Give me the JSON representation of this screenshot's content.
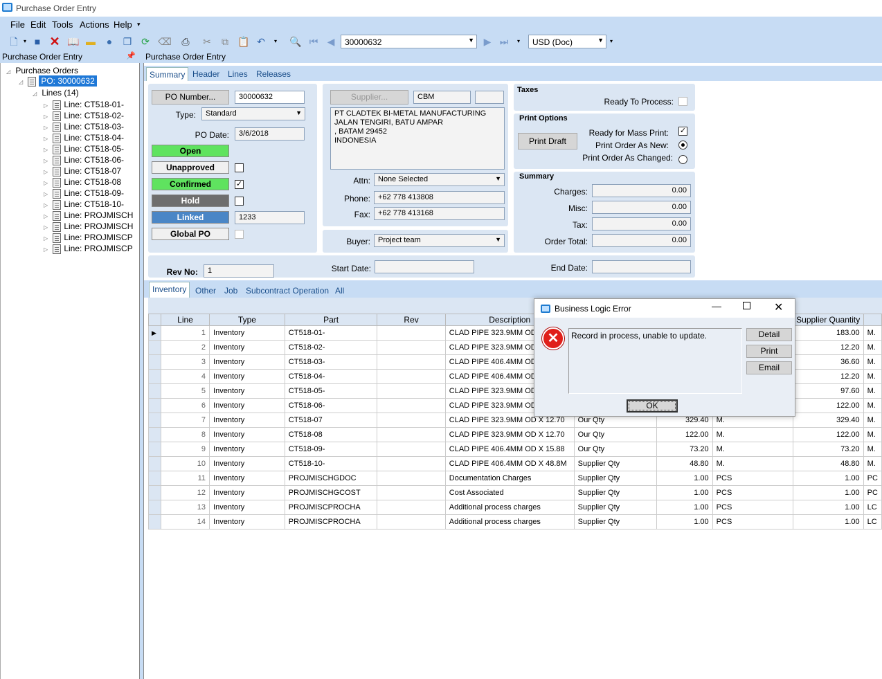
{
  "window": {
    "title": "Purchase Order Entry"
  },
  "menu": [
    "File",
    "Edit",
    "Tools",
    "Actions",
    "Help"
  ],
  "toolbar": {
    "po_number": "30000632",
    "currency": "USD (Doc)"
  },
  "left_panel": {
    "title": "Purchase Order Entry"
  },
  "right_panel": {
    "title": "Purchase Order Entry"
  },
  "tree": {
    "root": "Purchase Orders",
    "po": "PO: 30000632",
    "lines_node": "Lines (14)",
    "lines": [
      "Line: CT518-01-",
      "Line: CT518-02-",
      "Line: CT518-03-",
      "Line: CT518-04-",
      "Line: CT518-05-",
      "Line: CT518-06-",
      "Line: CT518-07",
      "Line: CT518-08",
      "Line: CT518-09-",
      "Line: CT518-10-",
      "Line: PROJMISCH",
      "Line: PROJMISCH",
      "Line: PROJMISCP",
      "Line: PROJMISCP"
    ]
  },
  "tabs": [
    "Summary",
    "Header",
    "Lines",
    "Releases"
  ],
  "summary": {
    "po_number_button": "PO Number...",
    "po_number": "30000632",
    "type_label": "Type:",
    "type": "Standard",
    "po_date_label": "PO Date:",
    "po_date": "3/6/2018",
    "status": {
      "open": "Open",
      "unapproved": "Unapproved",
      "confirmed": "Confirmed",
      "hold": "Hold",
      "linked": "Linked",
      "global_po": "Global PO"
    },
    "linked_value": "1233",
    "supplier_button": "Supplier...",
    "supplier_id": "CBM",
    "address": [
      "PT CLADTEK BI-METAL MANUFACTURING",
      "JALAN TENGIRI, BATU AMPAR",
      ", BATAM  29452",
      "INDONESIA"
    ],
    "attn_label": "Attn:",
    "attn": "None Selected",
    "phone_label": "Phone:",
    "phone": "+62 778 413808",
    "fax_label": "Fax:",
    "fax": "+62 778 413168",
    "buyer_label": "Buyer:",
    "buyer": "Project team",
    "taxes_title": "Taxes",
    "ready_to_process": "Ready To Process:",
    "print_options_title": "Print Options",
    "print_draft": "Print Draft",
    "ready_mass_print": "Ready for Mass Print:",
    "print_as_new": "Print Order As New:",
    "print_as_changed": "Print Order As Changed:",
    "summary_title": "Summary",
    "charges_label": "Charges:",
    "charges": "0.00",
    "misc_label": "Misc:",
    "misc": "0.00",
    "tax_label": "Tax:",
    "tax": "0.00",
    "total_label": "Order Total:",
    "total": "0.00",
    "rev_label": "Rev No:",
    "rev": "1",
    "start_label": "Start Date:",
    "end_label": "End Date:"
  },
  "subtabs": [
    "Inventory",
    "Other",
    "Job",
    "Subcontract Operation",
    "All"
  ],
  "grid": {
    "columns": [
      "Line",
      "Type",
      "Part",
      "Rev",
      "Description",
      "",
      "",
      "",
      "Supplier Quantity",
      ""
    ],
    "rows": [
      {
        "line": "1",
        "type": "Inventory",
        "part": "CT518-01-",
        "desc": "CLAD PIPE 323.9MM OD",
        "qtytype": "",
        "ourqty": "",
        "uom": "",
        "supqty": "183.00",
        "suom": "M."
      },
      {
        "line": "2",
        "type": "Inventory",
        "part": "CT518-02-",
        "desc": "CLAD PIPE 323.9MM OD",
        "qtytype": "",
        "ourqty": "",
        "uom": "",
        "supqty": "12.20",
        "suom": "M."
      },
      {
        "line": "3",
        "type": "Inventory",
        "part": "CT518-03-",
        "desc": "CLAD PIPE 406.4MM OD",
        "qtytype": "",
        "ourqty": "",
        "uom": "",
        "supqty": "36.60",
        "suom": "M."
      },
      {
        "line": "4",
        "type": "Inventory",
        "part": "CT518-04-",
        "desc": "CLAD PIPE 406.4MM OD",
        "qtytype": "",
        "ourqty": "",
        "uom": "",
        "supqty": "12.20",
        "suom": "M."
      },
      {
        "line": "5",
        "type": "Inventory",
        "part": "CT518-05-",
        "desc": "CLAD PIPE 323.9MM OD",
        "qtytype": "",
        "ourqty": "",
        "uom": "",
        "supqty": "97.60",
        "suom": "M."
      },
      {
        "line": "6",
        "type": "Inventory",
        "part": "CT518-06-",
        "desc": "CLAD PIPE 323.9MM OD",
        "qtytype": "",
        "ourqty": "",
        "uom": "",
        "supqty": "122.00",
        "suom": "M."
      },
      {
        "line": "7",
        "type": "Inventory",
        "part": "CT518-07",
        "desc": "CLAD PIPE 323.9MM OD X 12.70",
        "qtytype": "Our Qty",
        "ourqty": "329.40",
        "uom": "M.",
        "supqty": "329.40",
        "suom": "M."
      },
      {
        "line": "8",
        "type": "Inventory",
        "part": "CT518-08",
        "desc": "CLAD PIPE 323.9MM OD X 12.70",
        "qtytype": "Our Qty",
        "ourqty": "122.00",
        "uom": "M.",
        "supqty": "122.00",
        "suom": "M."
      },
      {
        "line": "9",
        "type": "Inventory",
        "part": "CT518-09-",
        "desc": "CLAD PIPE 406.4MM OD X 15.88",
        "qtytype": "Our Qty",
        "ourqty": "73.20",
        "uom": "M.",
        "supqty": "73.20",
        "suom": "M."
      },
      {
        "line": "10",
        "type": "Inventory",
        "part": "CT518-10-",
        "desc": "CLAD PIPE 406.4MM OD X 48.8M",
        "qtytype": "Supplier Qty",
        "ourqty": "48.80",
        "uom": "M.",
        "supqty": "48.80",
        "suom": "M."
      },
      {
        "line": "11",
        "type": "Inventory",
        "part": "PROJMISCHGDOC",
        "desc": "Documentation Charges",
        "qtytype": "Supplier Qty",
        "ourqty": "1.00",
        "uom": "PCS",
        "supqty": "1.00",
        "suom": "PC"
      },
      {
        "line": "12",
        "type": "Inventory",
        "part": "PROJMISCHGCOST",
        "desc": "Cost Associated",
        "qtytype": "Supplier Qty",
        "ourqty": "1.00",
        "uom": "PCS",
        "supqty": "1.00",
        "suom": "PC"
      },
      {
        "line": "13",
        "type": "Inventory",
        "part": "PROJMISCPROCHA",
        "desc": "Additional process charges",
        "qtytype": "Supplier Qty",
        "ourqty": "1.00",
        "uom": "PCS",
        "supqty": "1.00",
        "suom": "LC"
      },
      {
        "line": "14",
        "type": "Inventory",
        "part": "PROJMISCPROCHA",
        "desc": "Additional process charges",
        "qtytype": "Supplier Qty",
        "ourqty": "1.00",
        "uom": "PCS",
        "supqty": "1.00",
        "suom": "LC"
      }
    ]
  },
  "dialog": {
    "title": "Business Logic Error",
    "message": "Record in process, unable to update.",
    "detail": "Detail",
    "print": "Print",
    "email": "Email",
    "ok": "OK"
  },
  "colors": {
    "chrome": "#c7dcf4",
    "panel": "#dbe6f3",
    "green": "#5fe35f",
    "hold": "#6e6e6e",
    "linked": "#4a86c6",
    "error": "#e0201b"
  }
}
